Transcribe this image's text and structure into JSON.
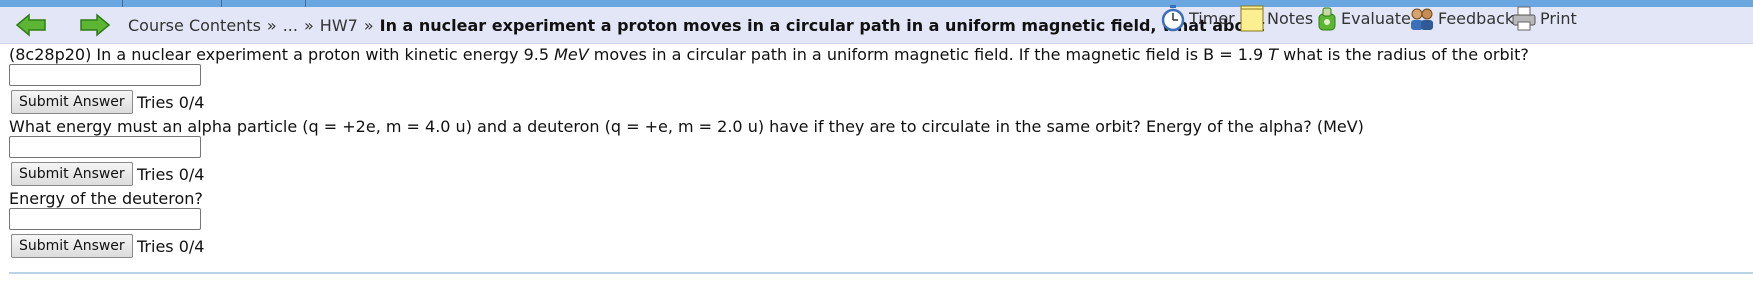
{
  "nav": {
    "course_contents": "Course Contents",
    "sep": "»",
    "ellipsis": "...",
    "hw": "HW7",
    "title": "In a nuclear experiment a proton moves in a circular path in a uniform magnetic field, what about",
    "collapse_glyph": "◄"
  },
  "tools": {
    "timer": "Timer",
    "notes": "Notes",
    "evaluate": "Evaluate",
    "feedback": "Feedback",
    "print": "Print"
  },
  "question1": {
    "pre": "(8c28p20) In a nuclear experiment a proton with kinetic energy 9.5 ",
    "unit1": "MeV",
    "mid": " moves in a circular path in a uniform magnetic field. If the magnetic field is B = 1.9 ",
    "unit2": "T",
    "post": " what is the radius of the orbit?"
  },
  "question2": "What energy must an alpha particle (q = +2e, m = 4.0 u) and a deuteron (q = +e, m = 2.0 u) have if they are to circulate in the same orbit? Energy of the alpha? (MeV)",
  "question3": "Energy of the deuteron?",
  "submit_label": "Submit Answer",
  "tries": [
    "Tries 0/4",
    "Tries 0/4",
    "Tries 0/4"
  ],
  "answers": [
    "",
    "",
    ""
  ],
  "colors": {
    "navbar": "#e3e6f7",
    "top_strip": "#6aa7e0",
    "arrow_green": "#4aa62b",
    "divider": "#b8d4e6"
  },
  "icons": [
    "arrow-left-icon",
    "arrow-right-icon",
    "stopwatch-icon",
    "notepad-icon",
    "evaluate-icon",
    "feedback-icon",
    "printer-icon"
  ]
}
